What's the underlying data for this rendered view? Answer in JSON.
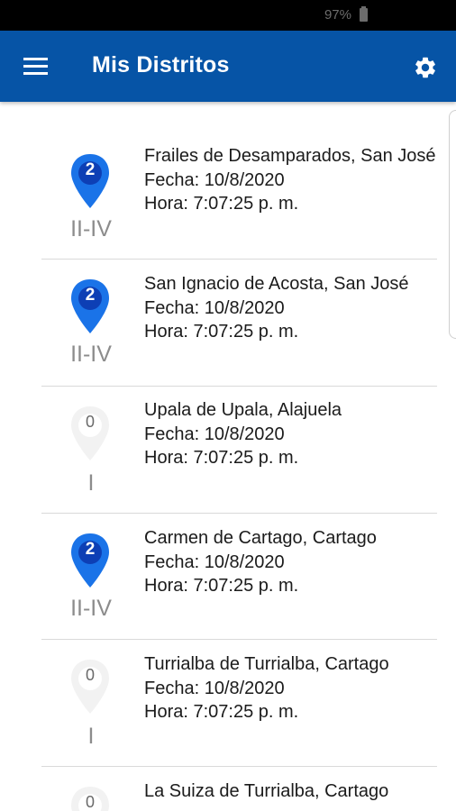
{
  "status_bar": {
    "battery": "97%"
  },
  "app_bar": {
    "title": "Mis Distritos"
  },
  "districts": [
    {
      "name": "Frailes de Desamparados, San José",
      "date": "Fecha: 10/8/2020",
      "time": "Hora: 7:07:25 p. m.",
      "count": "2",
      "level": "II-IV",
      "marker_color": "#1a73e8"
    },
    {
      "name": "San Ignacio de Acosta, San José",
      "date": "Fecha: 10/8/2020",
      "time": "Hora: 7:07:25 p. m.",
      "count": "2",
      "level": "II-IV",
      "marker_color": "#1a73e8"
    },
    {
      "name": "Upala de Upala, Alajuela",
      "date": "Fecha: 10/8/2020",
      "time": "Hora: 7:07:25 p. m.",
      "count": "0",
      "level": "I",
      "marker_color": "#f2f2f2"
    },
    {
      "name": "Carmen de Cartago, Cartago",
      "date": "Fecha: 10/8/2020",
      "time": "Hora: 7:07:25 p. m.",
      "count": "2",
      "level": "II-IV",
      "marker_color": "#1a73e8"
    },
    {
      "name": "Turrialba de Turrialba, Cartago",
      "date": "Fecha: 10/8/2020",
      "time": "Hora: 7:07:25 p. m.",
      "count": "0",
      "level": "I",
      "marker_color": "#f2f2f2"
    },
    {
      "name": "La Suiza de Turrialba, Cartago",
      "date": "",
      "time": "",
      "count": "0",
      "level": "",
      "marker_color": "#f2f2f2"
    }
  ]
}
